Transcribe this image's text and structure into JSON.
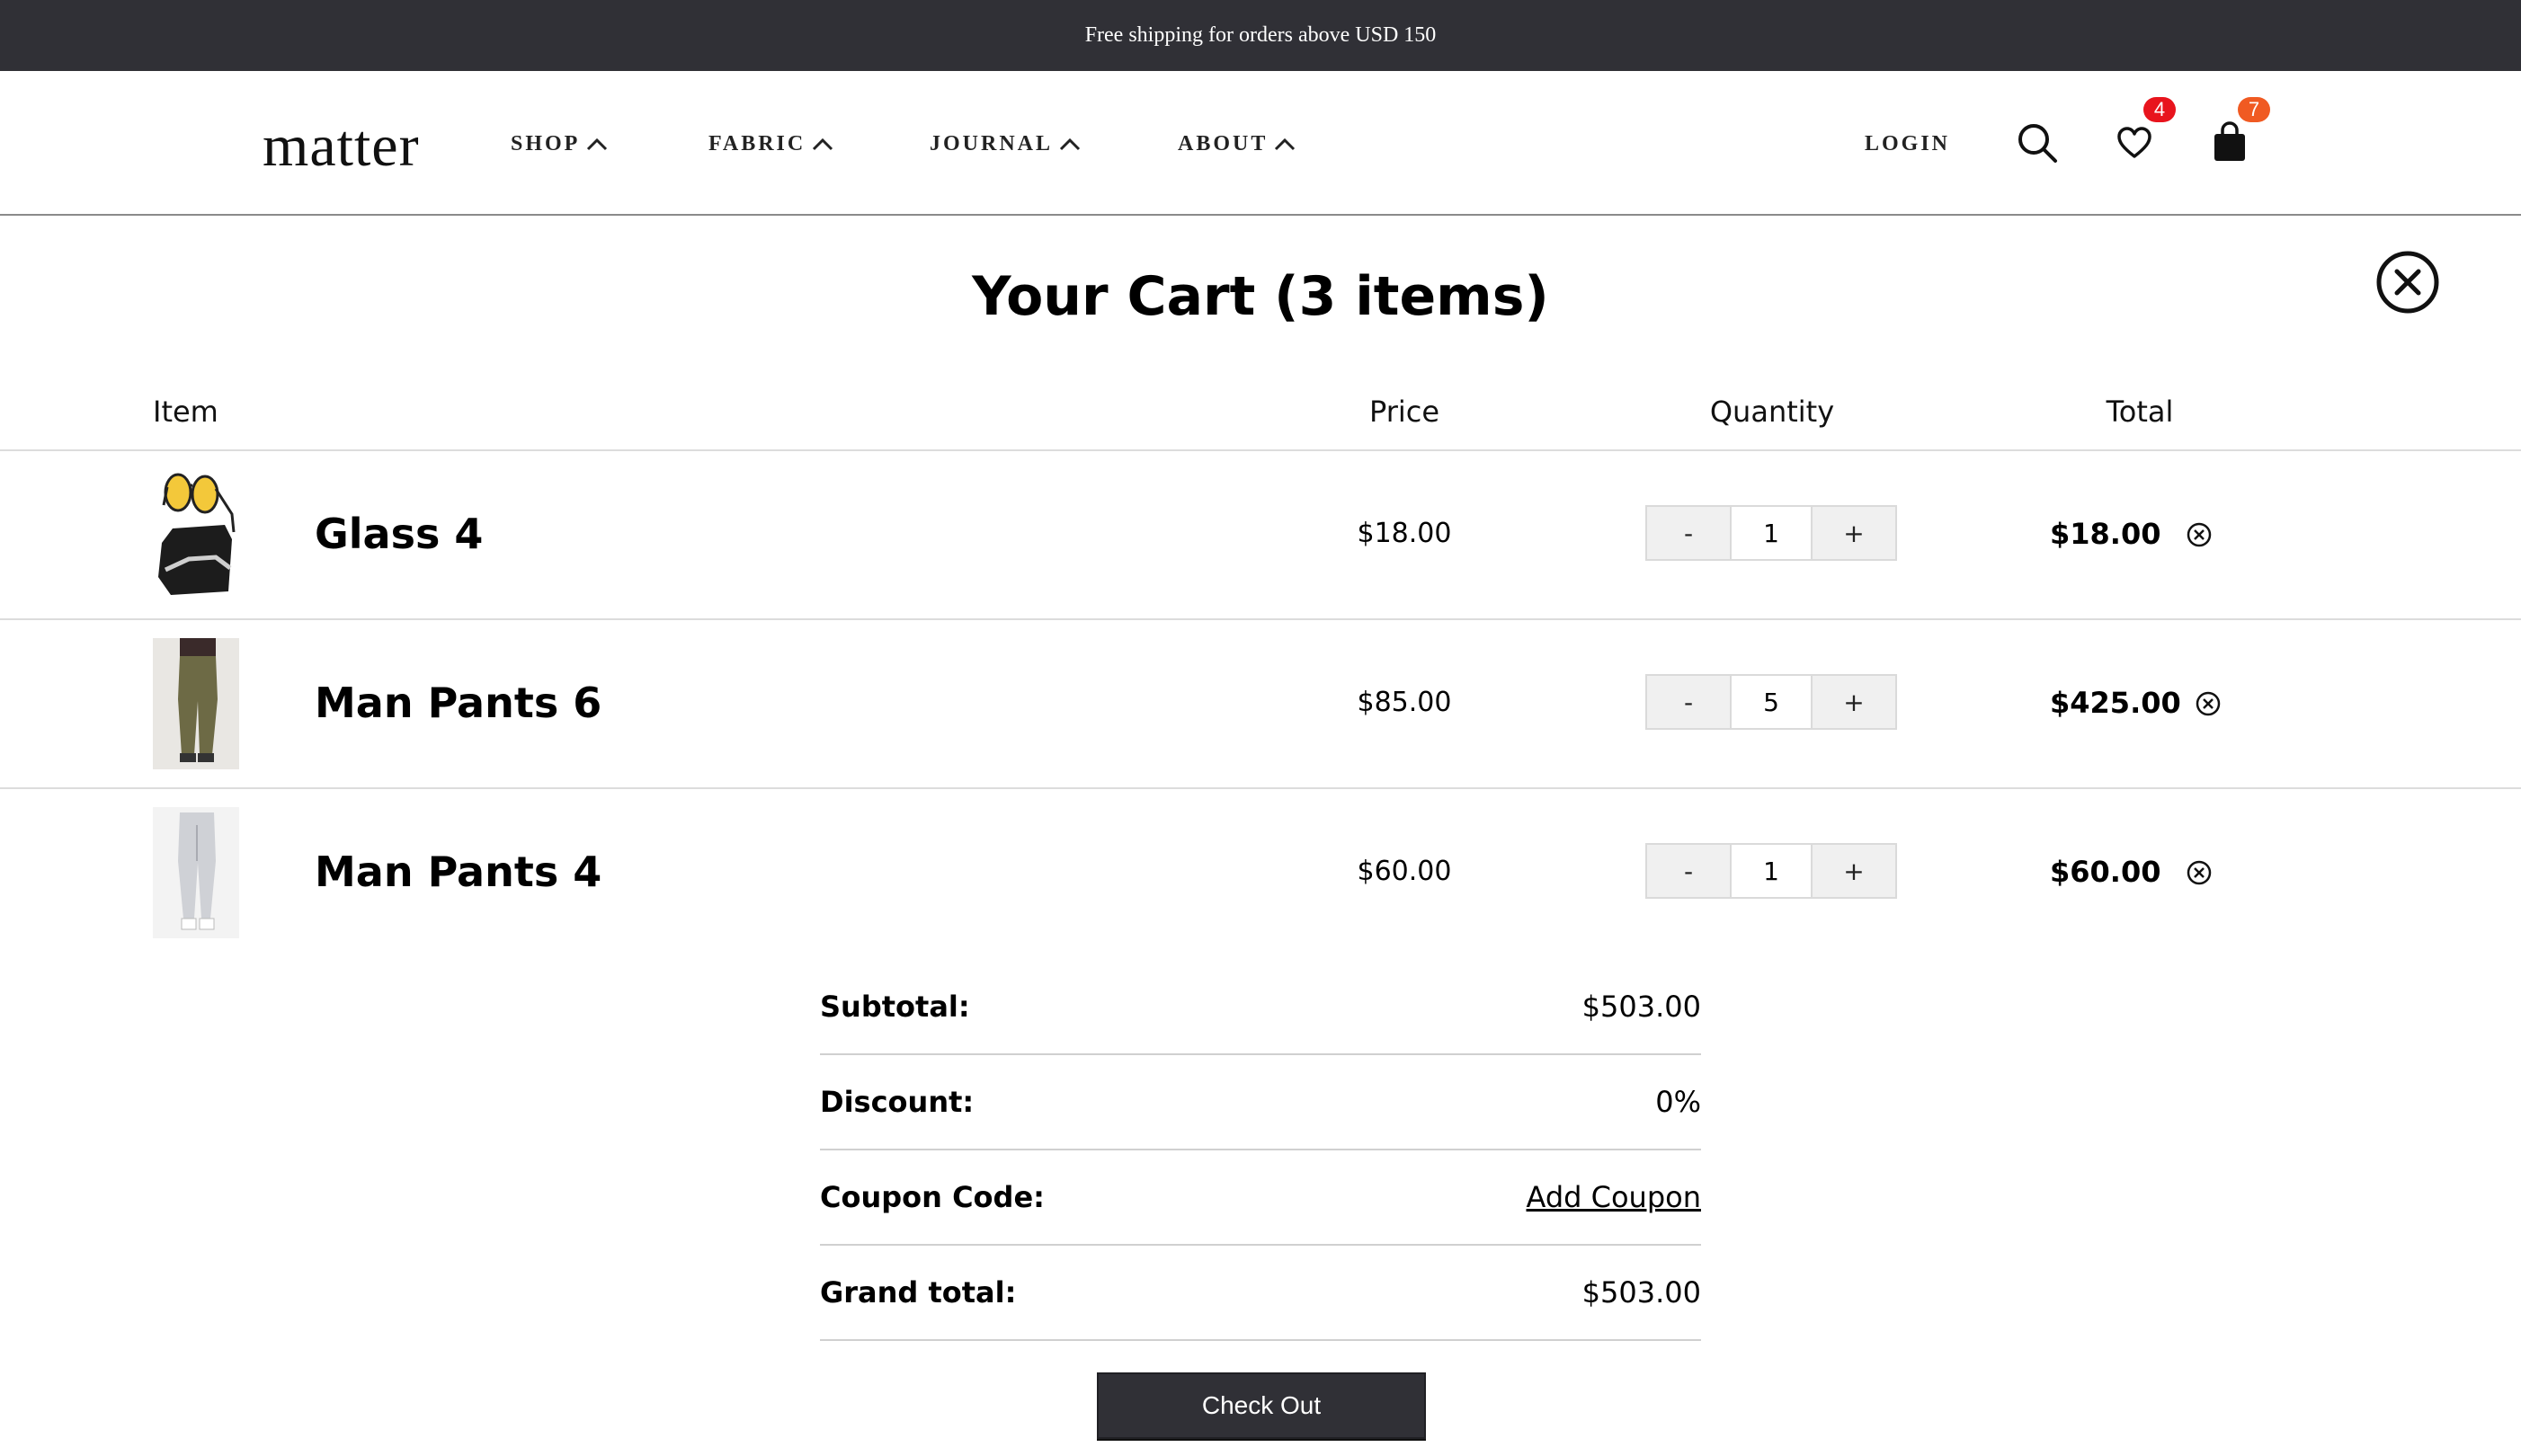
{
  "announcement": "Free shipping for orders above USD 150",
  "header": {
    "logo": "matter",
    "nav": [
      "SHOP",
      "FABRIC",
      "JOURNAL",
      "ABOUT"
    ],
    "login": "LOGIN",
    "wishlist_count": "4",
    "cart_count": "7",
    "wishlist_badge_color": "#e8141d",
    "cart_badge_color": "#f05a22"
  },
  "cart": {
    "title": "Your Cart (3 items)",
    "columns": {
      "item": "Item",
      "price": "Price",
      "quantity": "Quantity",
      "total": "Total"
    },
    "items": [
      {
        "name": "Glass 4",
        "price": "$18.00",
        "qty_minus": "-",
        "quantity": "1",
        "qty_plus": "+",
        "total": "$18.00"
      },
      {
        "name": "Man Pants 6",
        "price": "$85.00",
        "qty_minus": "-",
        "quantity": "5",
        "qty_plus": "+",
        "total": "$425.00"
      },
      {
        "name": "Man Pants 4",
        "price": "$60.00",
        "qty_minus": "-",
        "quantity": "1",
        "qty_plus": "+",
        "total": "$60.00"
      }
    ]
  },
  "summary": {
    "subtotal_label": "Subtotal:",
    "subtotal_value": "$503.00",
    "discount_label": "Discount:",
    "discount_value": "0%",
    "coupon_label": "Coupon Code:",
    "coupon_link": "Add Coupon",
    "grand_total_label": "Grand total:",
    "grand_total_value": "$503.00"
  },
  "checkout_label": "Check Out"
}
